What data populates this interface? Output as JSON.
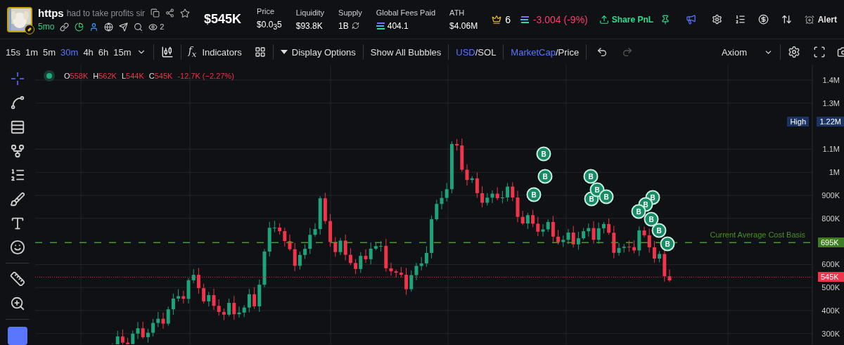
{
  "token": {
    "name": "https",
    "description": "had to take profits sir",
    "age": "5mo",
    "watchers": "2"
  },
  "market_cap": "$545K",
  "stats": [
    {
      "label": "Price",
      "value": "$0.0$_{3}$5",
      "kind": "plain"
    },
    {
      "label": "Liquidity",
      "value": "$93.8K",
      "kind": "plain"
    },
    {
      "label": "Supply",
      "value": "1B",
      "kind": "refresh"
    },
    {
      "label": "Global Fees Paid",
      "value": "404.1",
      "kind": "sol"
    },
    {
      "label": "ATH",
      "value": "$4.06M",
      "kind": "plain"
    }
  ],
  "holders": "6",
  "pnl": "-3.004 (-9%)",
  "share_button": "Share PnL",
  "alert_button": "Alert",
  "timeframes": [
    {
      "label": "15s",
      "selected": false
    },
    {
      "label": "1m",
      "selected": false
    },
    {
      "label": "5m",
      "selected": false
    },
    {
      "label": "30m",
      "selected": true
    },
    {
      "label": "4h",
      "selected": false
    },
    {
      "label": "6h",
      "selected": false
    },
    {
      "label": "15m",
      "selected": false
    }
  ],
  "toolbar": {
    "indicators_symbol": "f$_{x}$",
    "indicators": "Indicators",
    "display_options": "Display Options",
    "bubbles": "Show All Bubbles",
    "currency": [
      {
        "label": "USD",
        "selected": true
      },
      {
        "label": "SOL",
        "selected": false
      }
    ],
    "currency_separator": "/",
    "metric": [
      {
        "label": "MarketCap",
        "selected": true
      },
      {
        "label": "Price",
        "selected": false
      }
    ],
    "metric_separator": "/",
    "redo_disabled": true,
    "theme": "Axiom"
  },
  "legend": [
    {
      "key": "O",
      "value": "558K"
    },
    {
      "key": "H",
      "value": "562K"
    },
    {
      "key": "L",
      "value": "544K"
    },
    {
      "key": "C",
      "value": "545K"
    }
  ],
  "legend_change": "-12.7K (−2.27%)",
  "drawing_tools": [
    {
      "kind": "crosshair",
      "selected": true
    },
    {
      "kind": "line",
      "selected": false
    },
    {
      "kind": "fib",
      "selected": false
    },
    {
      "kind": "pattern",
      "selected": false
    },
    {
      "kind": "pitchfork",
      "selected": false
    },
    {
      "kind": "brush",
      "selected": false
    },
    {
      "kind": "text",
      "selected": false
    },
    {
      "kind": "emoji",
      "selected": false
    },
    {
      "kind": "ruler",
      "selected": false
    },
    {
      "kind": "zoom",
      "selected": false
    },
    {
      "kind": "color",
      "selected": false
    }
  ],
  "price_axis": [
    "1.4M",
    "1.3M",
    "1.1M",
    "1M",
    "900K",
    "800K",
    "600K",
    "500K",
    "400K",
    "300K"
  ],
  "high_label": {
    "tag": "High",
    "value": "1.22M"
  },
  "cost_basis": {
    "label": "Current Average Cost Basis",
    "value": "695K"
  },
  "last_price": "545K",
  "bubbles": [
    "B",
    "B",
    "B",
    "B",
    "B",
    "B",
    "B",
    "B",
    "B",
    "B",
    "B",
    "B",
    "B"
  ]
}
